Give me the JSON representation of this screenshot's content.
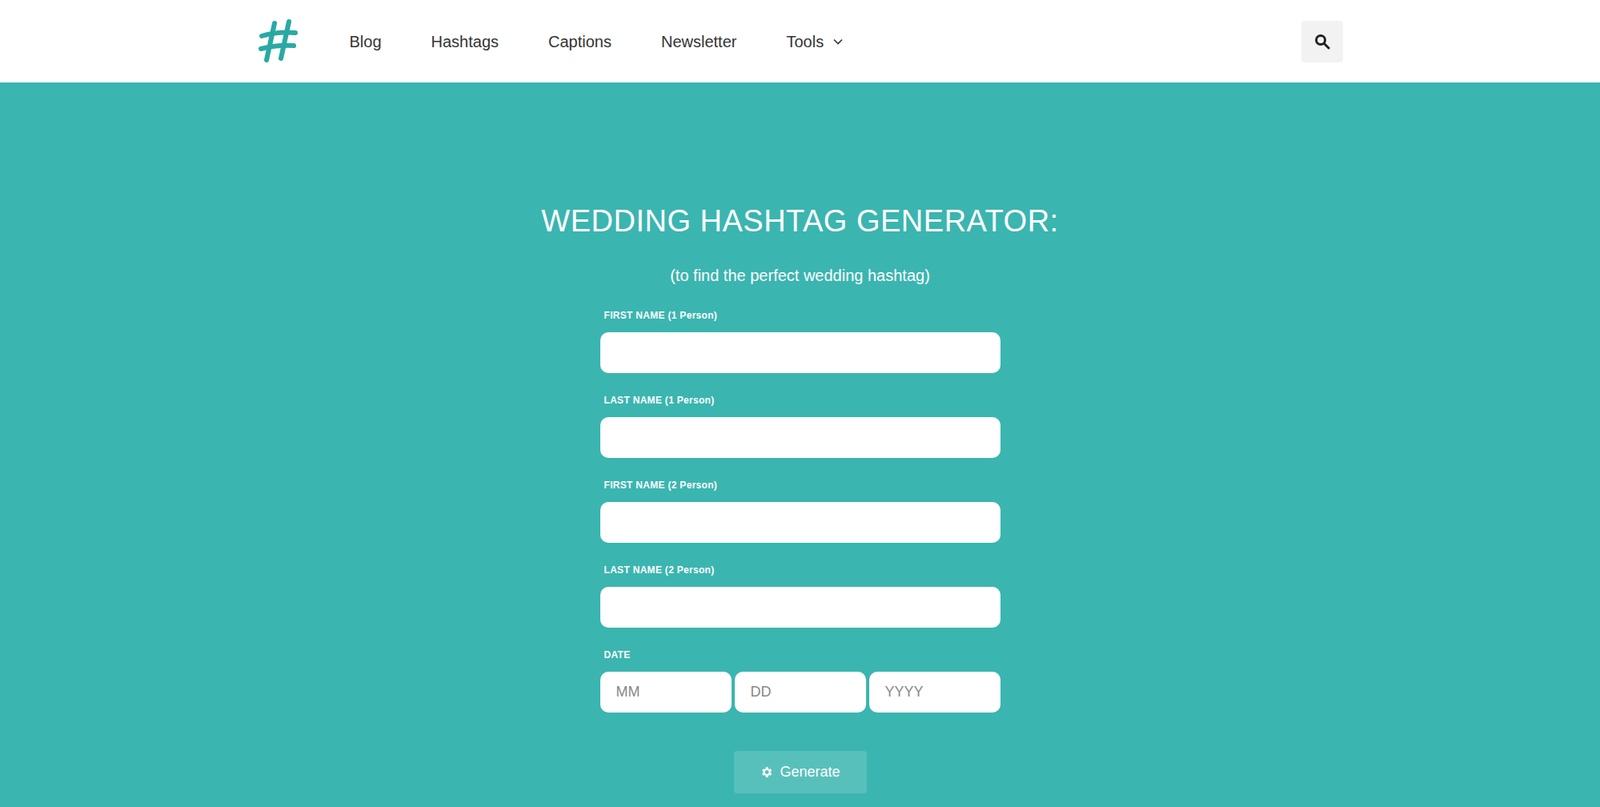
{
  "nav": {
    "items": [
      {
        "label": "Blog",
        "kind": "link"
      },
      {
        "label": "Hashtags",
        "kind": "link"
      },
      {
        "label": "Captions",
        "kind": "link"
      },
      {
        "label": "Newsletter",
        "kind": "link"
      },
      {
        "label": "Tools",
        "kind": "dropdown"
      }
    ]
  },
  "hero": {
    "title": "WEDDING HASHTAG GENERATOR:",
    "subtitle": "(to find the perfect wedding hashtag)"
  },
  "form": {
    "fields": [
      {
        "label": "FIRST NAME (1 Person)"
      },
      {
        "label": "LAST NAME (1 Person)"
      },
      {
        "label": "FIRST NAME (2 Person)"
      },
      {
        "label": "LAST NAME (2 Person)"
      }
    ],
    "date": {
      "label": "DATE",
      "placeholders": [
        "MM",
        "DD",
        "YYYY"
      ]
    },
    "button": "Generate"
  }
}
